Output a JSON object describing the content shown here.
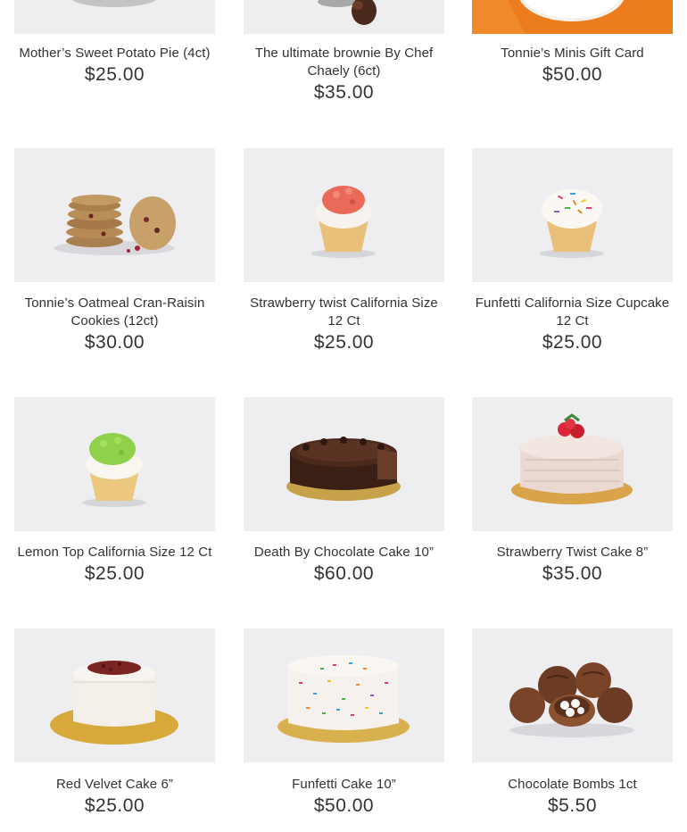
{
  "products": [
    {
      "name": "Mother’s Sweet Potato Pie (4ct)",
      "price": "$25.00",
      "icon": "sweet-potato-pie-image"
    },
    {
      "name": "The ultimate brownie By Chef Chaely (6ct)",
      "price": "$35.00",
      "icon": "brownie-image"
    },
    {
      "name": "Tonnie’s Minis Gift Card",
      "price": "$50.00",
      "icon": "gift-card-image",
      "accent": "#f0892a"
    },
    {
      "name": "Tonnie’s Oatmeal Cran-Raisin Cookies (12ct)",
      "price": "$30.00",
      "icon": "oatmeal-cookies-image"
    },
    {
      "name": "Strawberry twist California Size 12 Ct",
      "price": "$25.00",
      "icon": "strawberry-cupcake-image"
    },
    {
      "name": "Funfetti California Size Cupcake 12 Ct",
      "price": "$25.00",
      "icon": "funfetti-cupcake-image"
    },
    {
      "name": "Lemon Top California Size 12 Ct",
      "price": "$25.00",
      "icon": "lemon-cupcake-image"
    },
    {
      "name": "Death By Chocolate Cake 10”",
      "price": "$60.00",
      "icon": "chocolate-cake-image"
    },
    {
      "name": "Strawberry Twist Cake 8”",
      "price": "$35.00",
      "icon": "strawberry-cake-image"
    },
    {
      "name": "Red Velvet Cake 6”",
      "price": "$25.00",
      "icon": "red-velvet-cake-image"
    },
    {
      "name": "Funfetti Cake 10”",
      "price": "$50.00",
      "icon": "funfetti-cake-image"
    },
    {
      "name": "Chocolate Bombs 1ct",
      "price": "$5.50",
      "icon": "chocolate-bombs-image"
    }
  ]
}
